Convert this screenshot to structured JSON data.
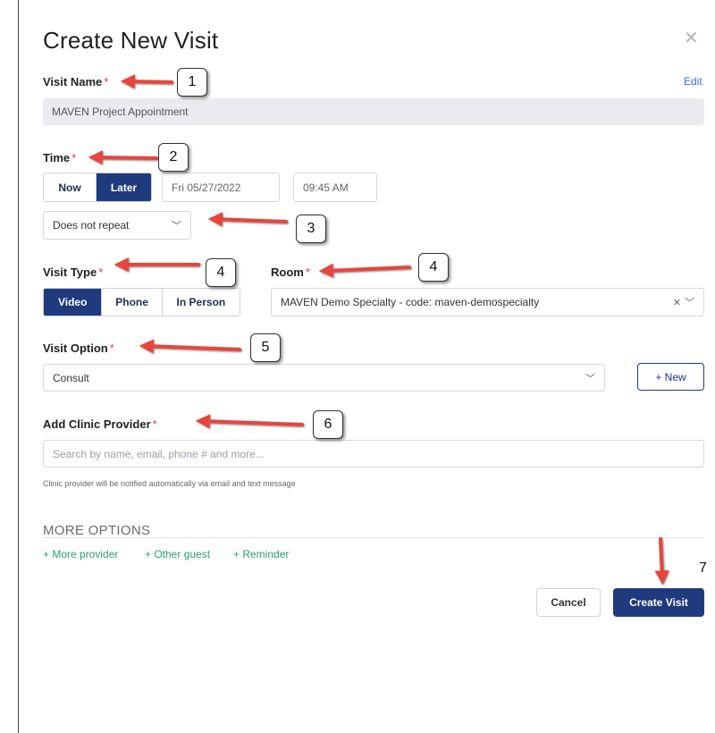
{
  "dialog": {
    "title": "Create New Visit",
    "close_icon": "close-icon",
    "required_mark": "*"
  },
  "visit_name": {
    "label": "Visit Name",
    "edit_label": "Edit",
    "value": "MAVEN Project Appointment"
  },
  "time": {
    "label": "Time",
    "options": [
      "Now",
      "Later"
    ],
    "selected": "Later",
    "date": "Fri 05/27/2022",
    "clock": "09:45 AM",
    "repeat": "Does not repeat"
  },
  "visit_type": {
    "label": "Visit Type",
    "options": [
      "Video",
      "Phone",
      "In Person"
    ],
    "selected": "Video"
  },
  "room": {
    "label": "Room",
    "value": "MAVEN Demo Specialty - code: maven-demospecialty",
    "clear_icon": "clear-icon",
    "chevron_icon": "chevron-down-icon"
  },
  "visit_option": {
    "label": "Visit Option",
    "value": "Consult",
    "new_button": "+ New"
  },
  "clinic_provider": {
    "label": "Add Clinic Provider",
    "placeholder": "Search by name, email, phone # and more...",
    "hint": "Clinic provider will be notified automatically via email and text message"
  },
  "more_options": {
    "title": "MORE OPTIONS",
    "links": [
      "+ More provider",
      "+ Other guest",
      "+ Reminder"
    ]
  },
  "footer": {
    "cancel": "Cancel",
    "create": "Create Visit"
  },
  "annotations": {
    "callouts": [
      "1",
      "2",
      "3",
      "4",
      "4",
      "5",
      "6",
      "7"
    ],
    "arrow_color": "#e8453c"
  },
  "colors": {
    "primary": "#1f3a7d",
    "required": "#e0394d",
    "link": "#3a6fd8",
    "green_link": "#2ea06b"
  }
}
